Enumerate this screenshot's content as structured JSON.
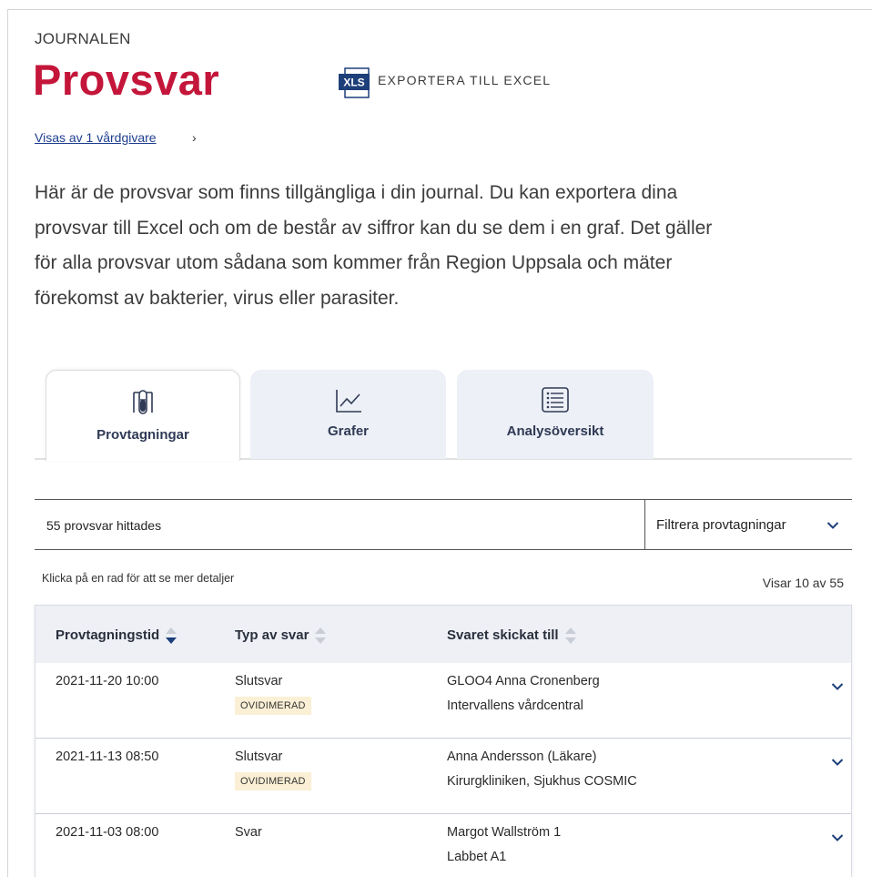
{
  "header": {
    "overline": "JOURNALEN",
    "title": "Provsvar",
    "export_icon_text": "XLS",
    "export_label": "EXPORTERA TILL EXCEL",
    "provider_link": "Visas av 1 vårdgivare",
    "provider_chevron": "›"
  },
  "intro": "Här är de provsvar som finns tillgängliga i din journal. Du kan exportera dina provsvar till Excel och om de består av siffror kan du se dem i en graf. Det gäller för alla provsvar utom sådana som kommer från Region Uppsala och mäter förekomst av bakterier, virus eller parasiter.",
  "tabs": [
    {
      "label": "Provtagningar",
      "icon": "test-tube-icon",
      "active": true
    },
    {
      "label": "Grafer",
      "icon": "line-chart-icon",
      "active": false
    },
    {
      "label": "Analysöversikt",
      "icon": "list-icon",
      "active": false
    }
  ],
  "results": {
    "count_text": "55 provsvar hittades",
    "filter_label": "Filtrera provtagningar",
    "hint": "Klicka på en rad för att se mer detaljer",
    "showing": "Visar 10 av 55"
  },
  "table": {
    "columns": [
      "Provtagningstid",
      "Typ av svar",
      "Svaret skickat till"
    ],
    "rows": [
      {
        "time": "2021-11-20 10:00",
        "type": "Slutsvar",
        "badge": "OVIDIMERAD",
        "recipient": "GLOO4 Anna Cronenberg",
        "unit": "Intervallens vårdcentral"
      },
      {
        "time": "2021-11-13 08:50",
        "type": "Slutsvar",
        "badge": "OVIDIMERAD",
        "recipient": "Anna Andersson (Läkare)",
        "unit": "Kirurgkliniken, Sjukhus COSMIC"
      },
      {
        "time": "2021-11-03 08:00",
        "type": "Svar",
        "badge": "",
        "recipient": "Margot Wallström 1",
        "unit": "Labbet A1"
      }
    ]
  },
  "colors": {
    "title": "#c4163a",
    "link": "#1f3f8f",
    "sort_active": "#1d3f7a",
    "badge_bg": "#fbf0d5",
    "tab_bg": "#edf0f6"
  }
}
